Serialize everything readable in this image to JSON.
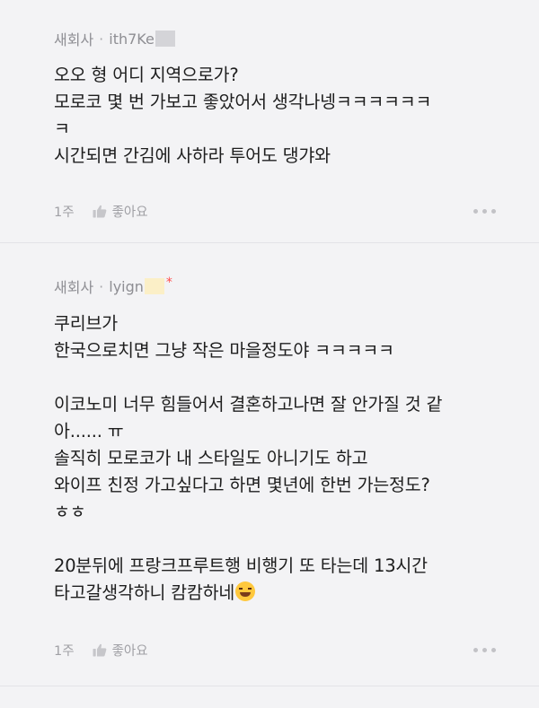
{
  "comments": [
    {
      "company": "새회사",
      "separator": "·",
      "author": "ith7Ke",
      "lines": [
        "오오 형 어디 지역으로가?",
        "모로코 몇 번 가보고 좋았어서 생각나넹ㅋㅋㅋㅋㅋㅋ",
        "ㅋ",
        "시간되면 간김에 사하라 투어도 댕갸와"
      ],
      "time": "1주",
      "like_label": "좋아요"
    },
    {
      "company": "새회사",
      "separator": "·",
      "author": "lyign",
      "author_mark": "*",
      "lines": [
        "쿠리브가",
        "한국으로치면 그냥 작은 마을정도야 ㅋㅋㅋㅋㅋ",
        "",
        "이코노미 너무 힘들어서 결혼하고나면 잘 안가질 것 같",
        "아...... ㅠ",
        "솔직히 모로코가 내 스타일도 아니기도 하고",
        "와이프 친정 가고싶다고 하면 몇년에 한번 가는정도?",
        "ㅎㅎ",
        "",
        "20분뒤에 프랑크프루트행 비행기 또 타는데 13시간",
        "타고갈생각하니 캄캄하네"
      ],
      "emoji": "rolling-on-floor-laughing-emoji",
      "time": "1주",
      "like_label": "좋아요"
    }
  ],
  "colors": {
    "background": "#f3f3f5",
    "meta_text": "#8e8e93",
    "body_text": "#1e1e1e",
    "author_mark": "#ff4d4d",
    "mask_gray": "#d4d4d8",
    "mask_yellow": "#fbefc7"
  }
}
